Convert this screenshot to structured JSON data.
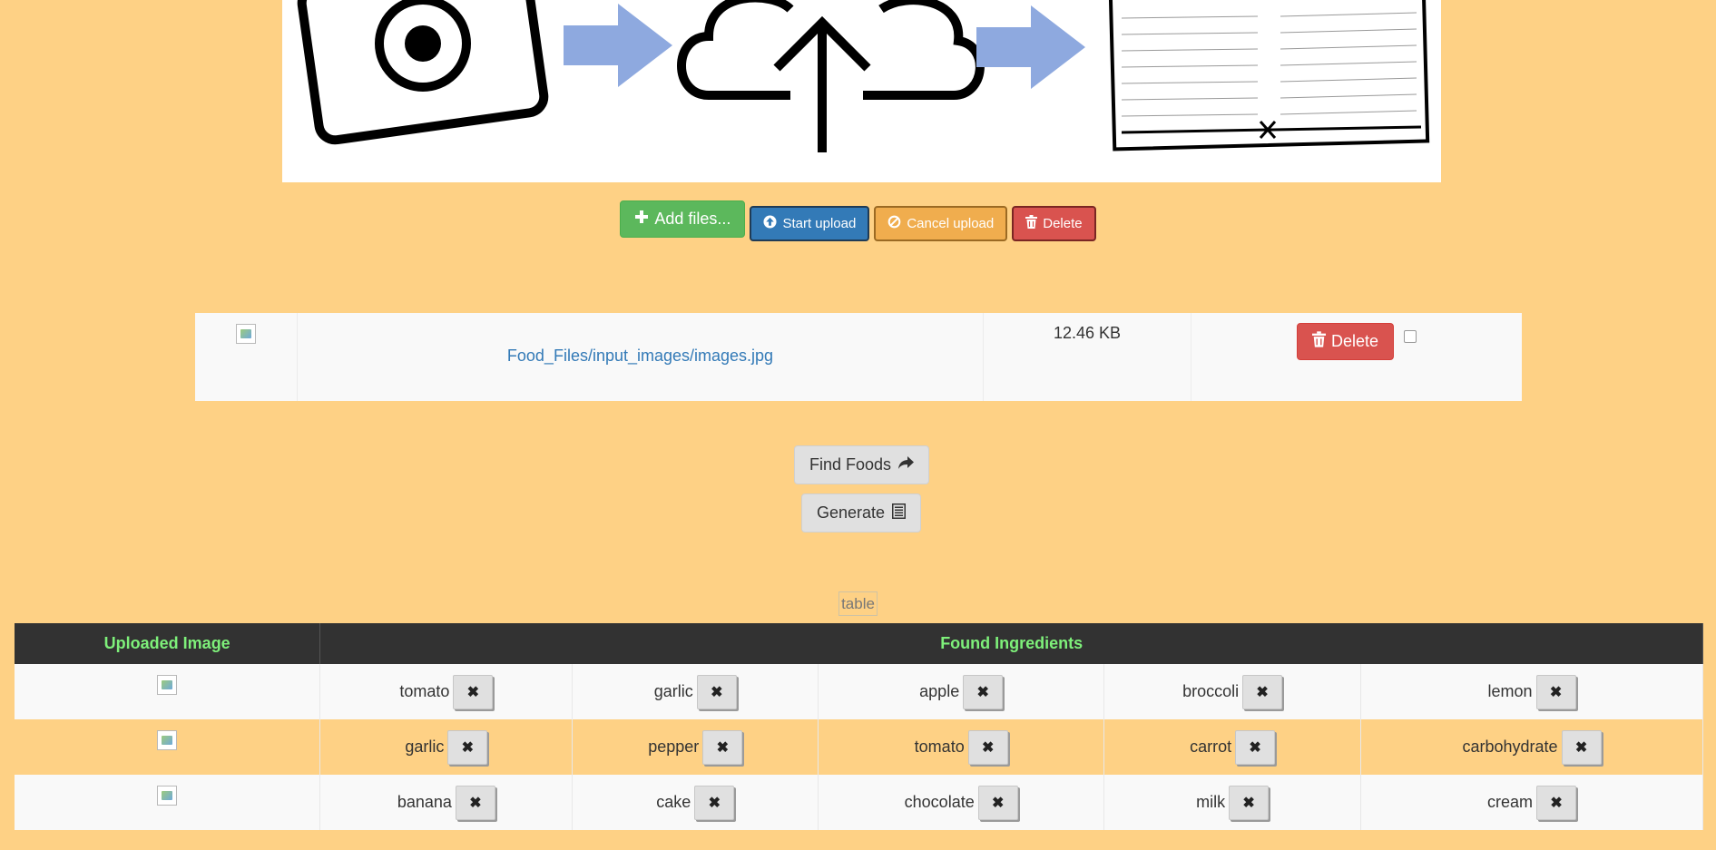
{
  "upload_bar": {
    "add_label": "Add files...",
    "start_label": "Start upload",
    "cancel_label": "Cancel upload",
    "delete_label": "Delete"
  },
  "file_row": {
    "name": "Food_Files/input_images/images.jpg",
    "size": "12.46 KB",
    "delete_label": "Delete"
  },
  "actions": {
    "find_label": "Find Foods",
    "generate_label": "Generate"
  },
  "table_caption": "table",
  "ingredients_table": {
    "headers": [
      "Uploaded Image",
      "Found Ingredients"
    ],
    "rows": [
      [
        "tomato",
        "garlic",
        "apple",
        "broccoli",
        "lemon"
      ],
      [
        "garlic",
        "pepper",
        "tomato",
        "carrot",
        "carbohydrate"
      ],
      [
        "banana",
        "cake",
        "chocolate",
        "milk",
        "cream"
      ]
    ]
  },
  "colors": {
    "background": "#fed185",
    "header_bg": "#323232",
    "header_text": "#7ef07a",
    "add": "#5cb85c",
    "start": "#337ab7",
    "cancel": "#f0ad4e",
    "delete": "#d9534f"
  },
  "icons": [
    "plus-icon",
    "upload-circle-icon",
    "ban-icon",
    "trash-icon",
    "share-arrow-icon",
    "list-icon",
    "close-icon"
  ]
}
